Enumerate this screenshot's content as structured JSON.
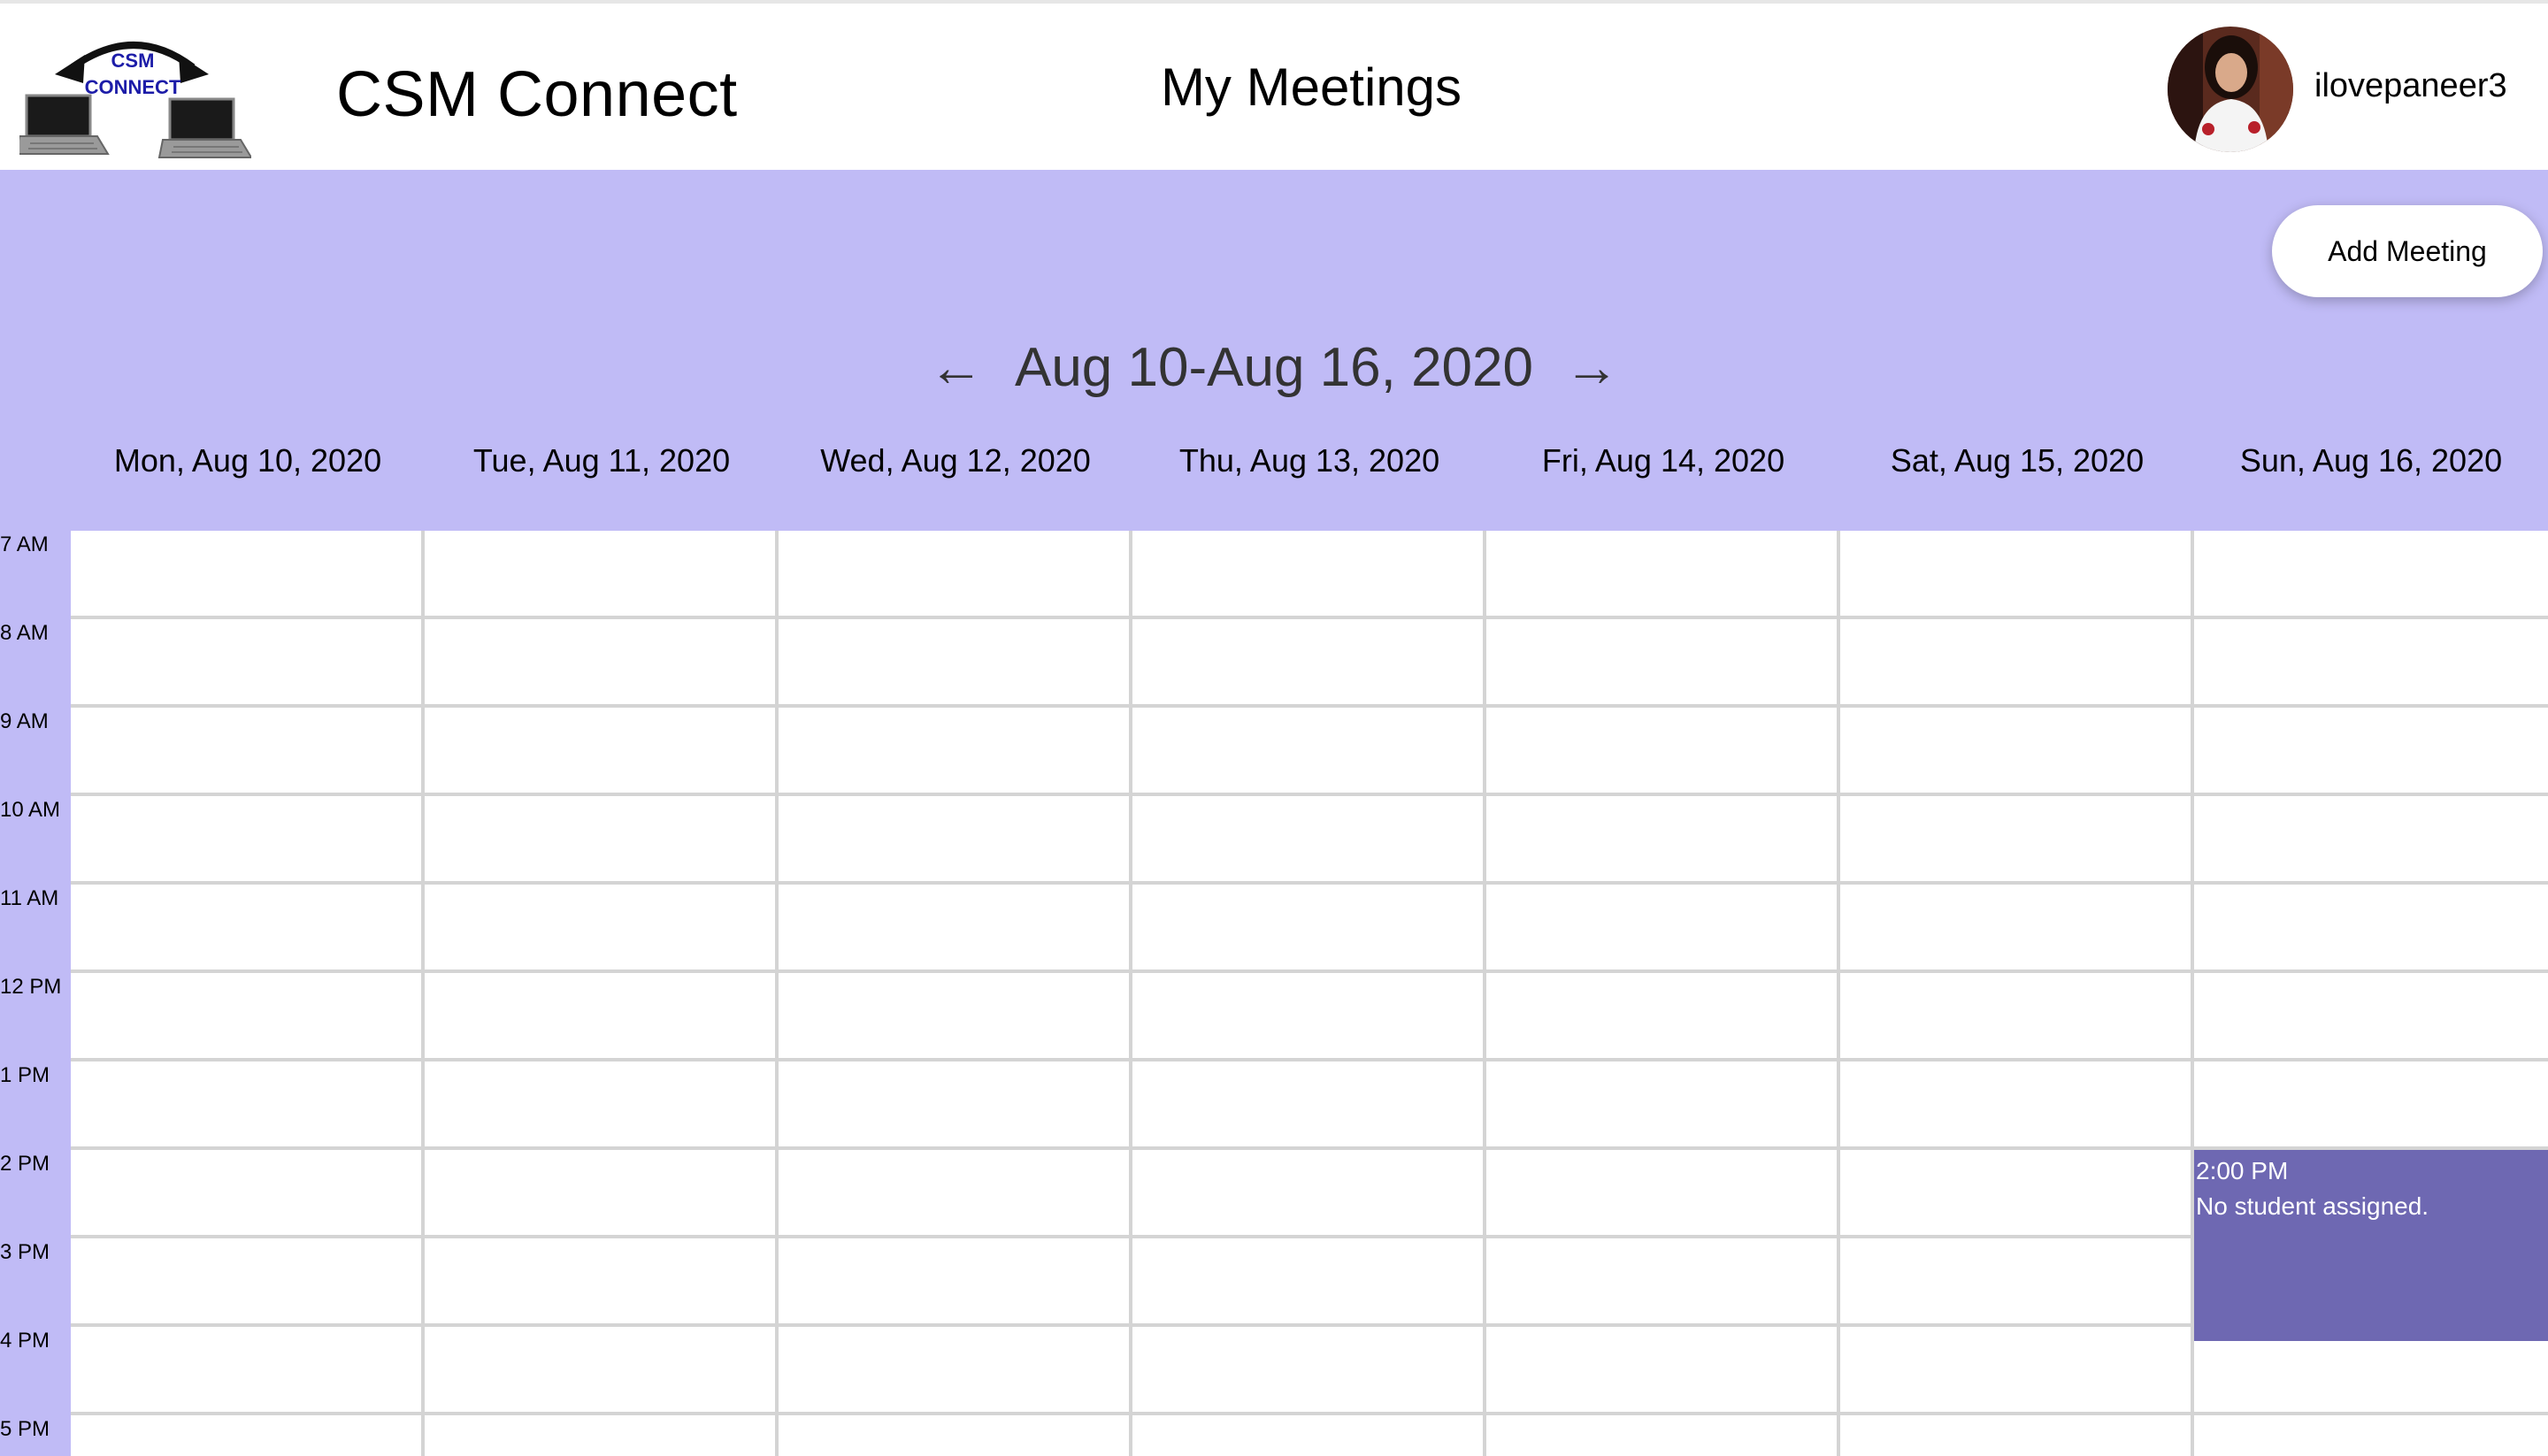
{
  "header": {
    "logo_text_top": "CSM",
    "logo_text_bottom": "CONNECT",
    "app_title": "CSM Connect",
    "page_title": "My Meetings",
    "username": "ilovepaneer3"
  },
  "toolbar": {
    "add_meeting_label": "Add Meeting"
  },
  "week_nav": {
    "prev_arrow": "←",
    "range": "Aug 10-Aug 16, 2020",
    "next_arrow": "→"
  },
  "days": [
    "Mon, Aug 10, 2020",
    "Tue, Aug 11, 2020",
    "Wed, Aug 12, 2020",
    "Thu, Aug 13, 2020",
    "Fri, Aug 14, 2020",
    "Sat, Aug 15, 2020",
    "Sun, Aug 16, 2020"
  ],
  "hours": [
    "7 AM",
    "8 AM",
    "9 AM",
    "10 AM",
    "11 AM",
    "12 PM",
    "1 PM",
    "2 PM",
    "3 PM",
    "4 PM",
    "5 PM"
  ],
  "events": [
    {
      "day": "Sun, Aug 16, 2020",
      "time": "2:00 PM",
      "description": "No student assigned."
    }
  ],
  "colors": {
    "banner": "#c0bbf6",
    "event": "#6e68b2",
    "grid_line": "#d4d4d4"
  }
}
